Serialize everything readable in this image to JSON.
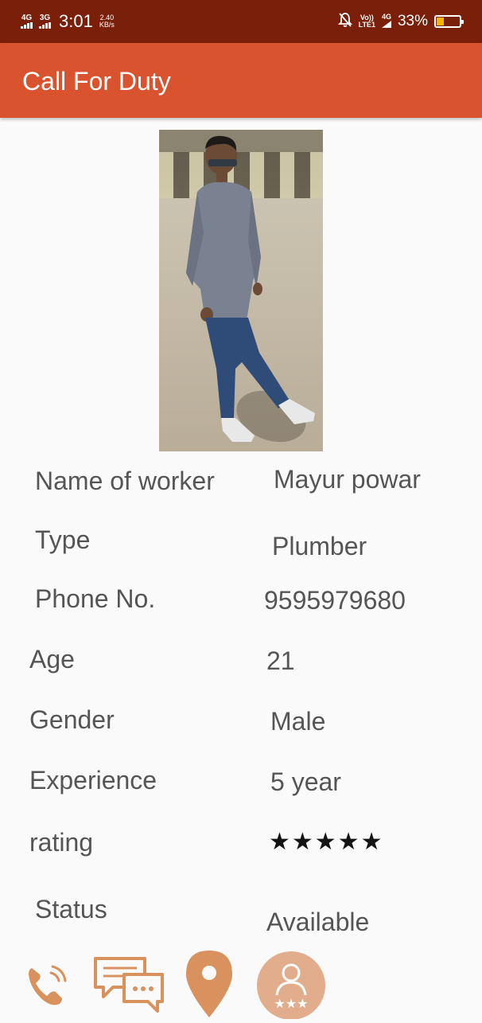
{
  "status_bar": {
    "network1": "4G",
    "network2": "3G",
    "time": "3:01",
    "speed_value": "2.40",
    "speed_unit": "KB/s",
    "volte_top": "Vo))",
    "volte_bottom": "LTE1",
    "network3": "4G",
    "battery_percent": "33%",
    "battery_level": 0.33,
    "battery_color": "#f5b400"
  },
  "app_bar": {
    "title": "Call For Duty",
    "color": "#d9532f"
  },
  "profile": {
    "photo_icon": "worker-photo",
    "fields": [
      {
        "label": "Name of worker",
        "value": "Mayur powar"
      },
      {
        "label": "Type",
        "value": "Plumber"
      },
      {
        "label": "Phone No.",
        "value": "9595979680"
      },
      {
        "label": "Age",
        "value": "21"
      },
      {
        "label": "Gender",
        "value": "Male"
      },
      {
        "label": "Experience",
        "value": "5 year"
      },
      {
        "label": "rating",
        "value": ""
      },
      {
        "label": "Status",
        "value": "Available"
      }
    ],
    "rating_stars": 5,
    "rating_text": "★★★★★"
  },
  "actions": [
    {
      "icon": "phone-call-icon"
    },
    {
      "icon": "chat-icon"
    },
    {
      "icon": "location-pin-icon"
    },
    {
      "icon": "rate-worker-icon"
    }
  ],
  "accent_color": "#d9a27c"
}
